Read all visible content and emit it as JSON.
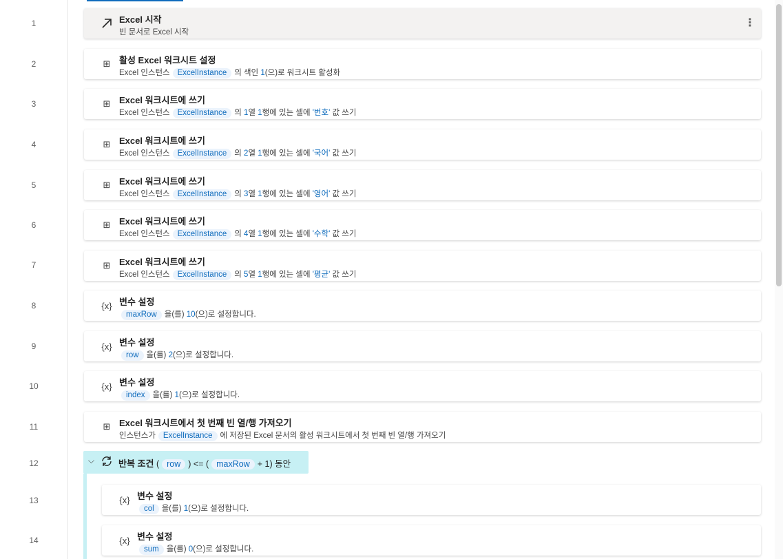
{
  "steps": [
    {
      "num": "1",
      "icon": "arrow-up-right-icon",
      "title": "Excel 시작",
      "desc": "빈 문서로 Excel 시작"
    },
    {
      "num": "2",
      "icon": "excel-icon",
      "title": "활성 Excel 워크시트 설정",
      "d1": "Excel 인스턴스",
      "tok": "ExcelInstance",
      "d2": "의 색인",
      "n1": "1",
      "d3": "(으)로 워크시트 활성화"
    },
    {
      "num": "3",
      "icon": "excel-icon",
      "title": "Excel 워크시트에 쓰기",
      "d1": "Excel 인스턴스",
      "tok": "ExcelInstance",
      "d2": "의",
      "n1": "1",
      "d3": "열",
      "n2": "1",
      "d4": "행에 있는 셀에",
      "s": "'번호'",
      "d5": "값 쓰기"
    },
    {
      "num": "4",
      "icon": "excel-icon",
      "title": "Excel 워크시트에 쓰기",
      "d1": "Excel 인스턴스",
      "tok": "ExcelInstance",
      "d2": "의",
      "n1": "2",
      "d3": "열",
      "n2": "1",
      "d4": "행에 있는 셀에",
      "s": "'국어'",
      "d5": "값 쓰기"
    },
    {
      "num": "5",
      "icon": "excel-icon",
      "title": "Excel 워크시트에 쓰기",
      "d1": "Excel 인스턴스",
      "tok": "ExcelInstance",
      "d2": "의",
      "n1": "3",
      "d3": "열",
      "n2": "1",
      "d4": "행에 있는 셀에",
      "s": "'영어'",
      "d5": "값 쓰기"
    },
    {
      "num": "6",
      "icon": "excel-icon",
      "title": "Excel 워크시트에 쓰기",
      "d1": "Excel 인스턴스",
      "tok": "ExcelInstance",
      "d2": "의",
      "n1": "4",
      "d3": "열",
      "n2": "1",
      "d4": "행에 있는 셀에",
      "s": "'수학'",
      "d5": "값 쓰기"
    },
    {
      "num": "7",
      "icon": "excel-icon",
      "title": "Excel 워크시트에 쓰기",
      "d1": "Excel 인스턴스",
      "tok": "ExcelInstance",
      "d2": "의",
      "n1": "5",
      "d3": "열",
      "n2": "1",
      "d4": "행에 있는 셀에",
      "s": "'평균'",
      "d5": "값 쓰기"
    },
    {
      "num": "8",
      "icon": "variable-icon",
      "title": "변수 설정",
      "tok": "maxRow",
      "d1": "을(를)",
      "n1": "10",
      "d2": "(으)로 설정합니다."
    },
    {
      "num": "9",
      "icon": "variable-icon",
      "title": "변수 설정",
      "tok": "row",
      "d1": "을(를)",
      "n1": "2",
      "d2": "(으)로 설정합니다."
    },
    {
      "num": "10",
      "icon": "variable-icon",
      "title": "변수 설정",
      "tok": "index",
      "d1": "을(를)",
      "n1": "1",
      "d2": "(으)로 설정합니다."
    },
    {
      "num": "11",
      "icon": "excel-icon",
      "title": "Excel 워크시트에서 첫 번째 빈 열/행 가져오기",
      "d1": "인스턴스가",
      "tok": "ExcelInstance",
      "d2": "에 저장된 Excel 문서의 활성 워크시트에서 첫 번째 빈 열/행 가져오기"
    },
    {
      "num": "12",
      "icon": "loop-icon",
      "title": "반복 조건",
      "p1": "(",
      "tok1": "row",
      "op": ") <= (",
      "tok2": "maxRow",
      "p2": "+ 1) 동안"
    },
    {
      "num": "13",
      "icon": "variable-icon",
      "title": "변수 설정",
      "tok": "col",
      "d1": "을(를)",
      "n1": "1",
      "d2": "(으)로 설정합니다."
    },
    {
      "num": "14",
      "icon": "variable-icon",
      "title": "변수 설정",
      "tok": "sum",
      "d1": "을(를)",
      "n1": "0",
      "d2": "(으)로 설정합니다."
    }
  ],
  "icons": {
    "excel": "⊞",
    "variable": "{x}",
    "chevron": "⌵",
    "more": "⋮"
  },
  "colors": {
    "accent": "#0f6cbd",
    "loop_bg": "#c7f0f4",
    "token_bg": "#ebf3fc"
  }
}
